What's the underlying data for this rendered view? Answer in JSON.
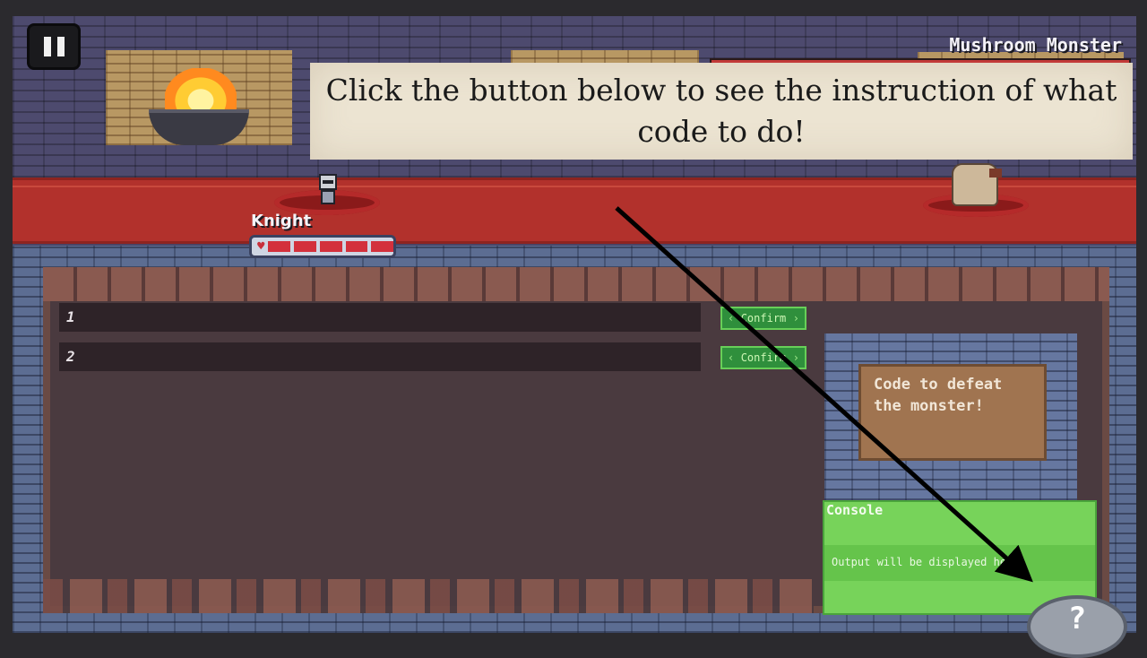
{
  "hud": {
    "pause_icon": "pause-icon",
    "monster_name": "Mushroom Monster",
    "monster_health_fraction": 1.0
  },
  "banner": {
    "text": "Click the button below to see the instruction of what code to do!"
  },
  "hero": {
    "name": "Knight",
    "health_segments_filled": 5,
    "health_segments_total": 5,
    "heart_icon": "heart-icon"
  },
  "editor": {
    "lines": [
      {
        "number": "1",
        "confirm_label": "Confirm"
      },
      {
        "number": "2",
        "confirm_label": "Confirm"
      }
    ]
  },
  "hint_panel": {
    "text": "Code to defeat the monster!"
  },
  "console": {
    "title": "Console",
    "output": "Output will be displayed here."
  },
  "help_button": {
    "label": "?"
  },
  "colors": {
    "carpet": "#b2312c",
    "console": "#77d35a",
    "confirm": "#2f8f3c",
    "banner": "#ece4d2"
  }
}
